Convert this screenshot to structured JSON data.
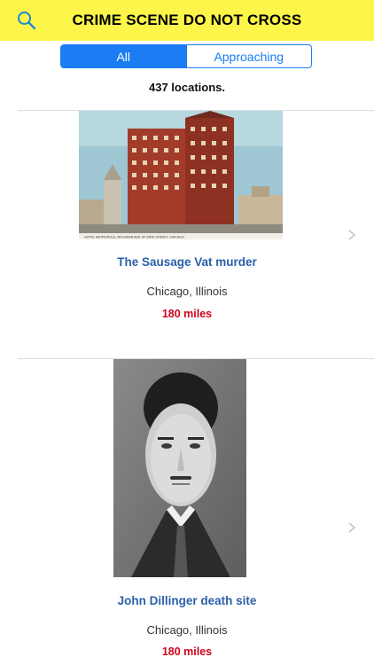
{
  "header": {
    "title": "CRIME SCENE DO NOT CROSS",
    "search_icon": "search-icon",
    "bg_color": "#fef54a"
  },
  "filter": {
    "options": [
      "All",
      "Approaching"
    ],
    "selected": "All",
    "accent": "#1b7cf3"
  },
  "summary": {
    "count_text": "437 locations."
  },
  "locations": [
    {
      "title": "The Sausage Vat murder",
      "location": "Chicago, Illinois",
      "distance": "180 miles",
      "image_caption": "HOTEL METROPOLE, MICHIGAN AVE. AT 23RD STREET, CHICAGO"
    },
    {
      "title": "John Dillinger death site",
      "location": "Chicago, Illinois",
      "distance": "180 miles"
    }
  ],
  "colors": {
    "title_link": "#2a5fa8",
    "distance": "#d0021b"
  }
}
